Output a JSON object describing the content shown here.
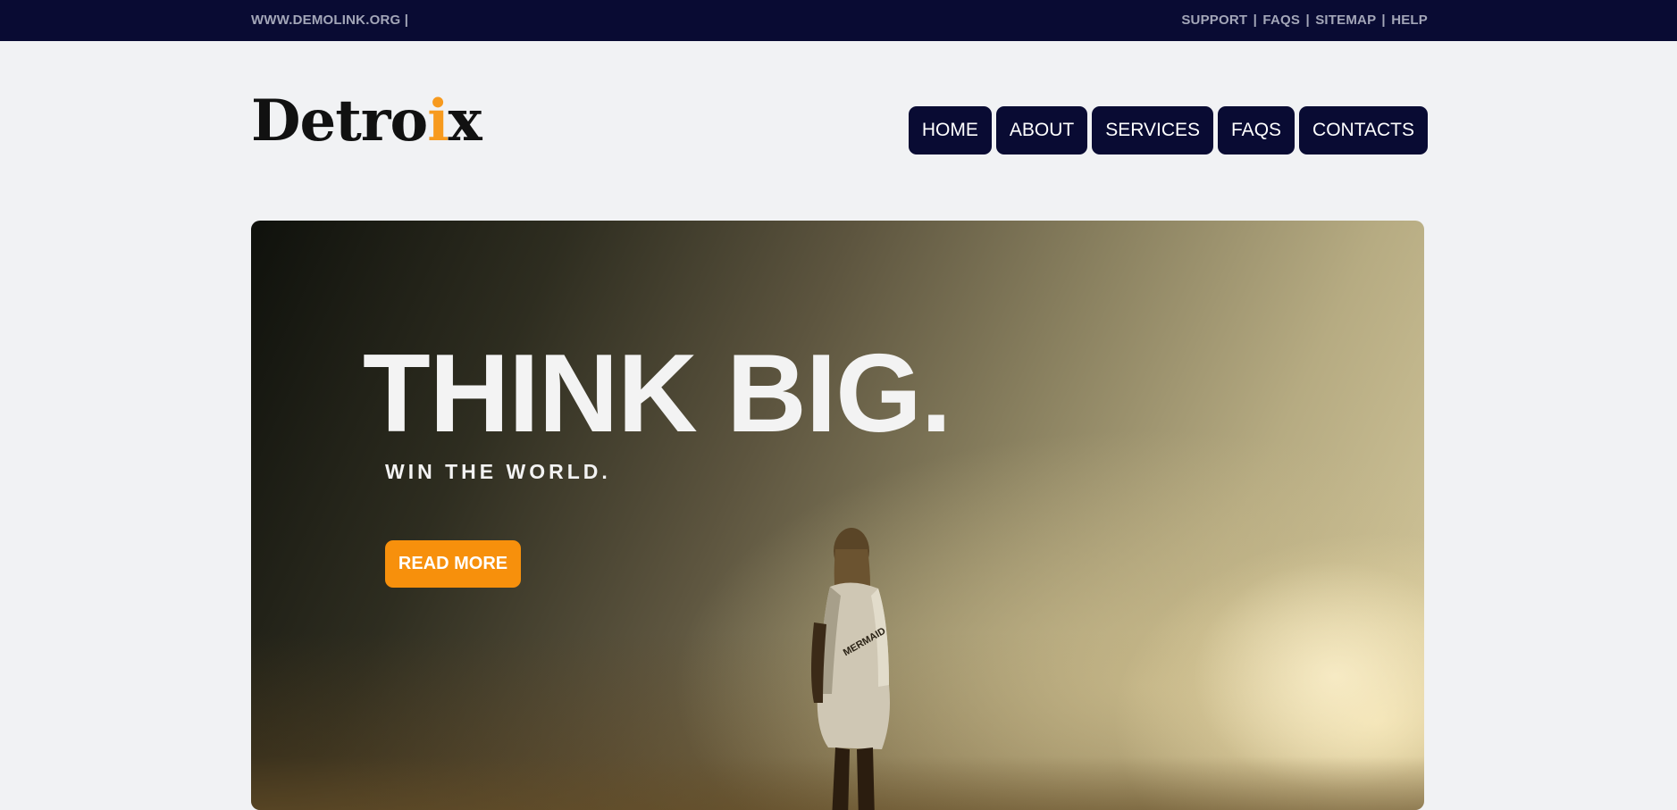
{
  "topbar": {
    "site": "WWW.DEMOLINK.ORG |",
    "links": [
      "SUPPORT",
      "FAQS",
      "SITEMAP",
      "HELP"
    ],
    "separator": "|"
  },
  "brand": {
    "logo_main": "Detro",
    "logo_accent": "i",
    "logo_end": "x",
    "accent_color": "#f79a1e"
  },
  "nav": {
    "items": [
      "HOME",
      "ABOUT",
      "SERVICES",
      "FAQS",
      "CONTACTS"
    ]
  },
  "hero": {
    "title": "THINK BIG.",
    "subtitle": "WIN THE WORLD.",
    "button_label": "READ MORE",
    "button_color": "#f7900c",
    "shirt_text": "MERMAID"
  },
  "colors": {
    "navy": "#090b33",
    "background": "#f1f2f4"
  }
}
